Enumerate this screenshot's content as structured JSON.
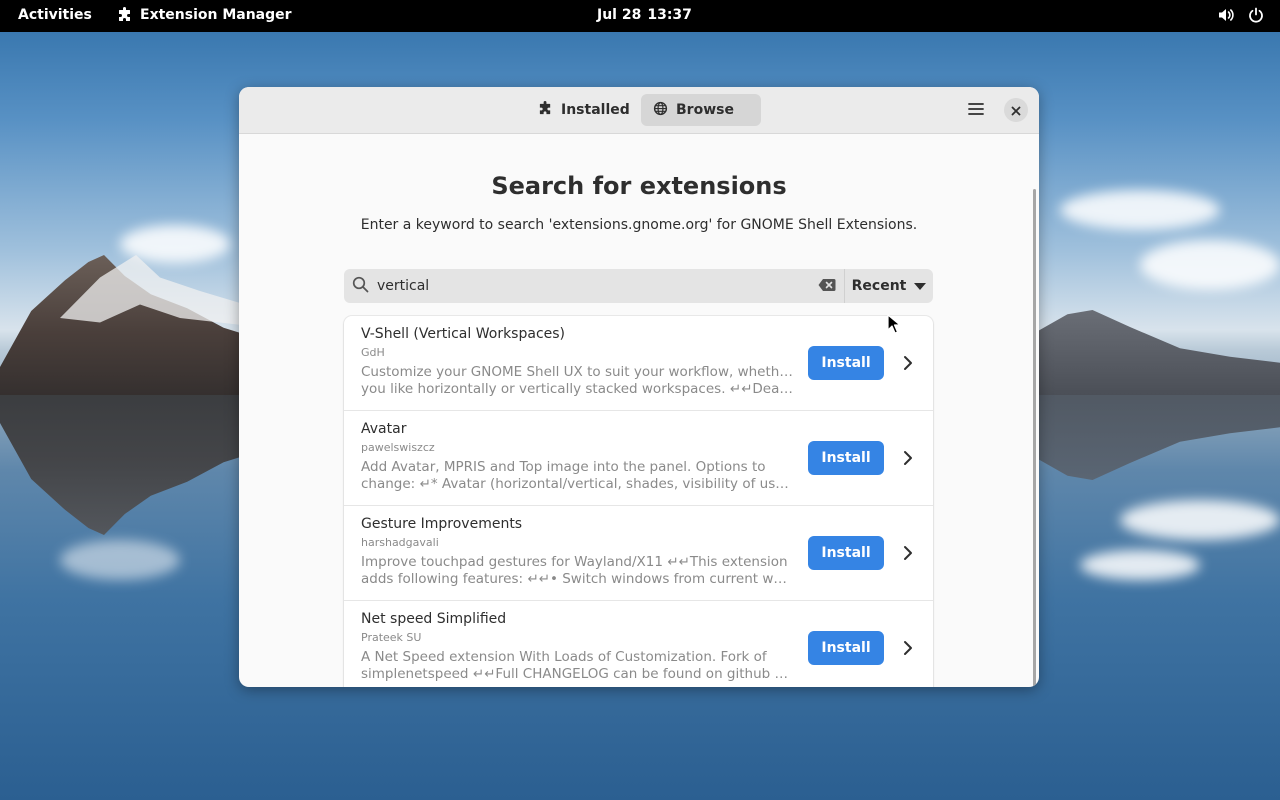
{
  "topbar": {
    "activities": "Activities",
    "app_name": "Extension Manager",
    "app_icon": "puzzle-icon",
    "date": "Jul 28",
    "time": "13:37",
    "tray_icons": [
      "volume-icon",
      "power-icon"
    ]
  },
  "window": {
    "tabs": [
      {
        "label": "Installed",
        "icon": "puzzle-icon",
        "active": false
      },
      {
        "label": "Browse",
        "icon": "globe-icon",
        "active": true
      }
    ],
    "menu_icon": "hamburger-icon",
    "close_icon": "close-icon"
  },
  "page": {
    "title": "Search for extensions",
    "subtitle": "Enter a keyword to search 'extensions.gnome.org' for GNOME Shell Extensions."
  },
  "search": {
    "value": "vertical",
    "sort": "Recent"
  },
  "results": [
    {
      "name": "V-Shell (Vertical Workspaces)",
      "author": "GdH",
      "desc_line1": "Customize your GNOME Shell UX to suit your workflow, whether",
      "desc_line2": "you like horizontally or vertically stacked workspaces. ↵↵Dear us…",
      "button": "Install"
    },
    {
      "name": "Avatar",
      "author": "pawelswiszcz",
      "desc_line1": "Add Avatar, MPRIS and Top image into the panel. Options to",
      "desc_line2": "change: ↵* Avatar (horizontal/vertical, shades, visibility of user…",
      "button": "Install"
    },
    {
      "name": "Gesture Improvements",
      "author": "harshadgavali",
      "desc_line1": "Improve touchpad gestures for Wayland/X11 ↵↵This extension",
      "desc_line2": "adds following features: ↵↵• Switch windows from current works…",
      "button": "Install"
    },
    {
      "name": "Net speed Simplified",
      "author": "Prateek SU",
      "desc_line1": "A Net Speed extension With Loads of Customization. Fork of",
      "desc_line2": "simplenetspeed ↵↵Full CHANGELOG can be found on github rele…",
      "button": "Install"
    }
  ],
  "colors": {
    "accent": "#3584e4",
    "topbar": "#000000",
    "window_bg": "#fafafa"
  }
}
